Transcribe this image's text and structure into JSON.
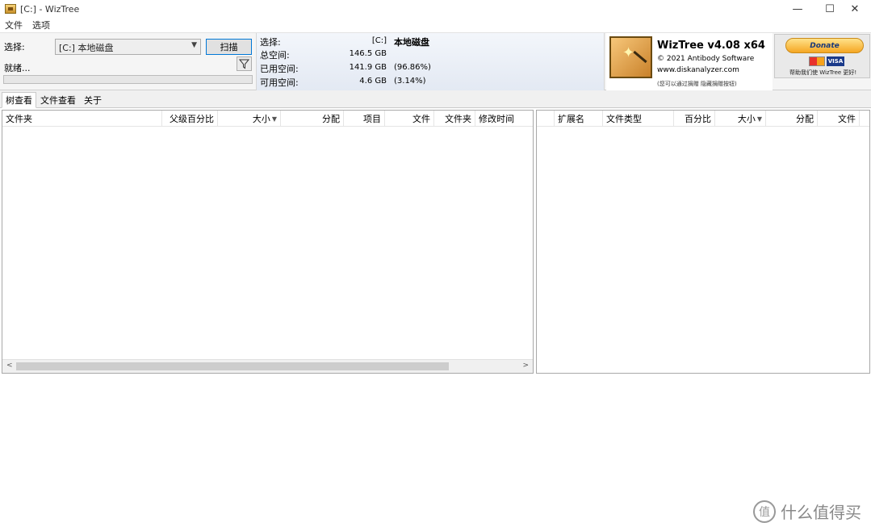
{
  "window": {
    "title": "[C:]  - WizTree",
    "minimize": "—",
    "maximize": "☐",
    "close": "✕"
  },
  "menu": [
    "文件",
    "选项"
  ],
  "scan": {
    "select_label": "选择:",
    "drive_value": "[C:] 本地磁盘",
    "scan_button": "扫描",
    "status": "就绪..."
  },
  "stats": {
    "select_label": "选择:",
    "select_drive": "[C:]",
    "select_name": "本地磁盘",
    "total_label": "总空间:",
    "total_value": "146.5 GB",
    "used_label": "已用空间:",
    "used_value": "141.9 GB",
    "used_percent": "(96.86%)",
    "free_label": "可用空间:",
    "free_value": "4.6 GB",
    "free_percent": "(3.14%)"
  },
  "logo": {
    "title": "WizTree v4.08 x64",
    "copyright": "© 2021 Antibody Software",
    "url": "www.diskanalyzer.com",
    "note": "(您可以通过捐赠 隐藏捐赠按钮)"
  },
  "donate": {
    "button": "Donate",
    "visa": "VISA",
    "note": "帮助我们使 WizTree 更好!"
  },
  "tabs": [
    "树查看",
    "文件查看",
    "关于"
  ],
  "tree_columns": [
    "文件夹",
    "父级百分比",
    "大小",
    "分配",
    "项目",
    "文件",
    "文件夹",
    "修改时间"
  ],
  "ext_columns": [
    "扩展名",
    "文件类型",
    "百分比",
    "大小",
    "分配",
    "文件"
  ],
  "scroll": {
    "left": "<",
    "right": ">"
  },
  "watermark": {
    "icon": "值",
    "text": "什么值得买"
  }
}
